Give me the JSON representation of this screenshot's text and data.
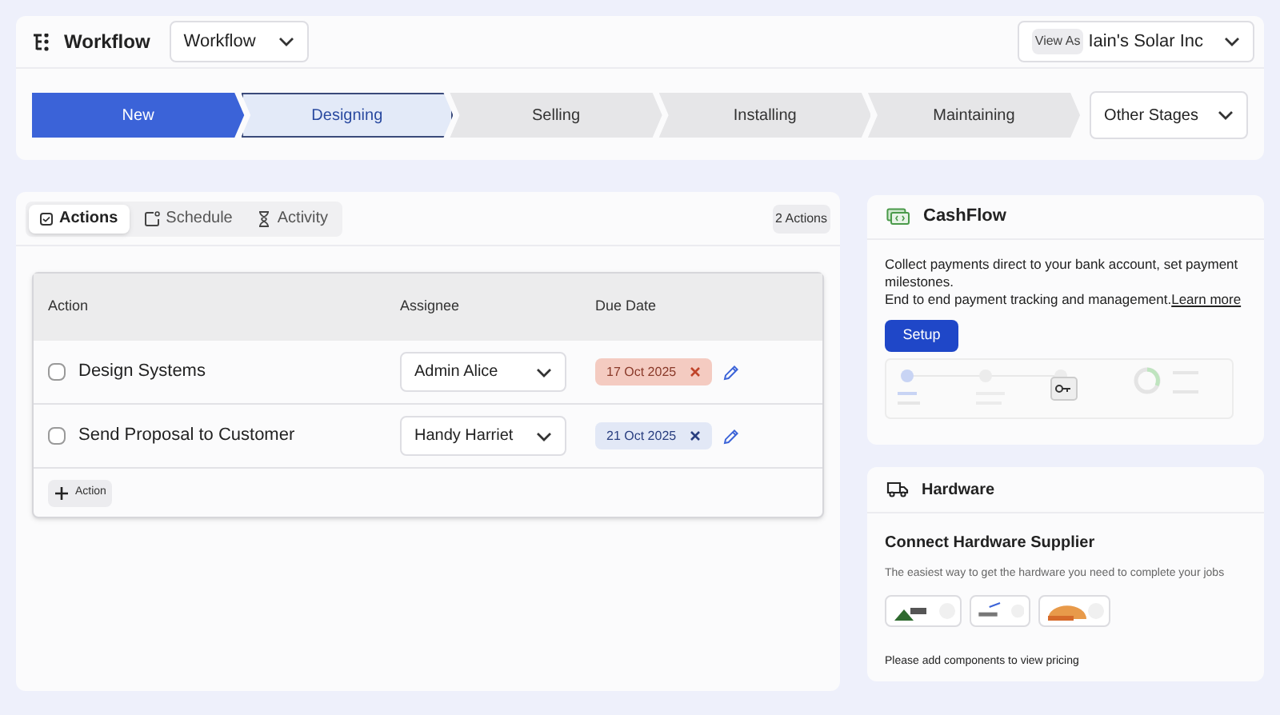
{
  "header": {
    "title": "Workflow",
    "workflow_select": "Workflow",
    "view_as_label": "View As",
    "view_as_value": "Iain's Solar Inc"
  },
  "stages": [
    {
      "label": "New",
      "completed": true,
      "selected": false
    },
    {
      "label": "Designing",
      "completed": false,
      "selected": true
    },
    {
      "label": "Selling",
      "completed": false,
      "selected": false
    },
    {
      "label": "Installing",
      "completed": false,
      "selected": false
    },
    {
      "label": "Maintaining",
      "completed": false,
      "selected": false
    }
  ],
  "other_stages": "Other Stages",
  "tabs": [
    {
      "label": "Actions",
      "selected": true
    },
    {
      "label": "Schedule",
      "selected": false
    },
    {
      "label": "Activity",
      "selected": false
    }
  ],
  "actions_count": "2 Actions",
  "table": {
    "columns": [
      "Action",
      "Assignee",
      "Due Date"
    ],
    "rows": [
      {
        "action": "Design Systems",
        "checked": false,
        "assignee": "Admin Alice",
        "due_date": "17 Oct 2025",
        "overdue": true
      },
      {
        "action": "Send Proposal to Customer",
        "checked": false,
        "assignee": "Handy Harriet",
        "due_date": "21 Oct 2025",
        "overdue": false
      }
    ]
  },
  "add_action": "Action",
  "cashflow": {
    "title": "CashFlow",
    "lines": [
      "Collect payments direct to your bank account, set payment milestones.",
      "End to end payment tracking and management."
    ],
    "link": "Learn more",
    "button": "Setup"
  },
  "hardware": {
    "title": "Hardware",
    "heading": "Connect Hardware Supplier",
    "subtitle": "The easiest way to get the hardware you need to complete your jobs",
    "suppliers": [
      {
        "kind": "mountain"
      },
      {
        "kind": "swoosh"
      },
      {
        "kind": "sun"
      }
    ],
    "note": "Please add components to view pricing"
  }
}
